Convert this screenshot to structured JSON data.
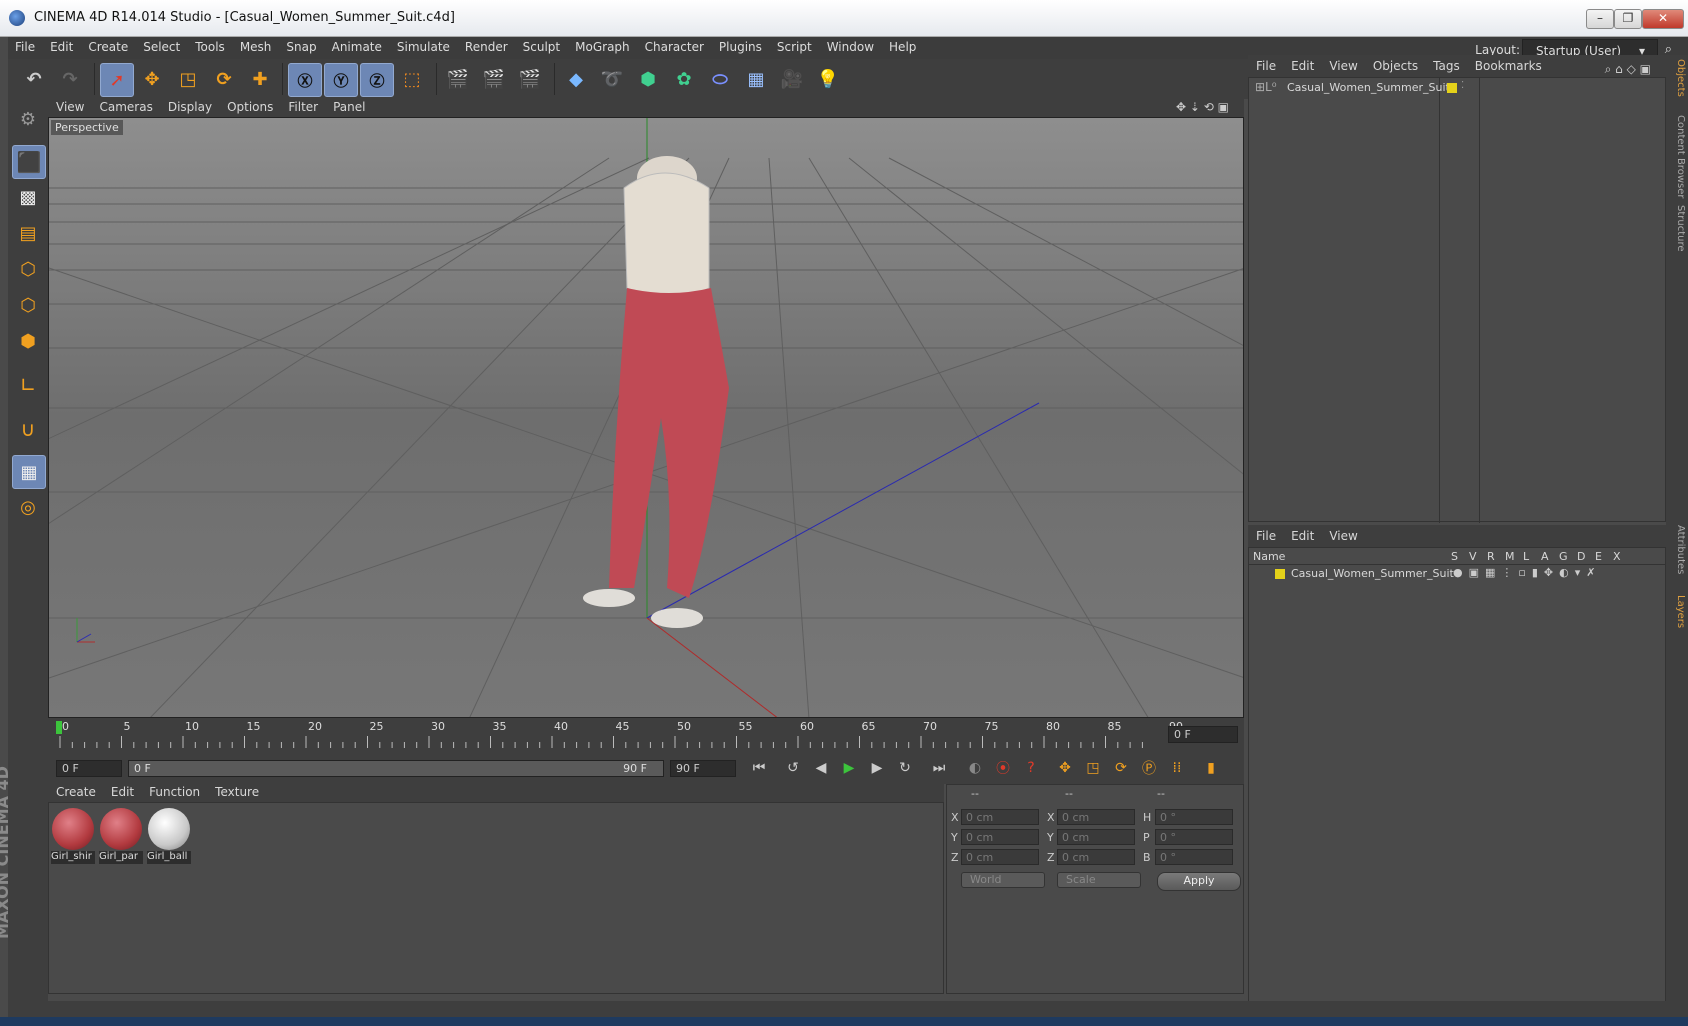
{
  "window": {
    "title": "CINEMA 4D R14.014 Studio - [Casual_Women_Summer_Suit.c4d]",
    "minimize": "–",
    "maximize": "❐",
    "close": "✕"
  },
  "menubar": {
    "items": [
      "File",
      "Edit",
      "Create",
      "Select",
      "Tools",
      "Mesh",
      "Snap",
      "Animate",
      "Simulate",
      "Render",
      "Sculpt",
      "MoGraph",
      "Character",
      "Plugins",
      "Script",
      "Window",
      "Help"
    ],
    "layout_label": "Layout:",
    "layout_value": "Startup (User)"
  },
  "viewport": {
    "menu": [
      "View",
      "Cameras",
      "Display",
      "Options",
      "Filter",
      "Panel"
    ],
    "label": "Perspective"
  },
  "timeline": {
    "ticks": [
      "0",
      "5",
      "10",
      "15",
      "20",
      "25",
      "30",
      "35",
      "40",
      "45",
      "50",
      "55",
      "60",
      "65",
      "70",
      "75",
      "80",
      "85",
      "90"
    ],
    "current_frame": "0 F",
    "start_field": "0 F",
    "range_start": "0 F",
    "range_end": "90 F",
    "end_field": "90 F"
  },
  "material_manager": {
    "menu": [
      "Create",
      "Edit",
      "Function",
      "Texture"
    ],
    "materials": [
      {
        "name": "Girl_shir",
        "color": "#b23a3f"
      },
      {
        "name": "Girl_par",
        "color": "#b23a3f"
      },
      {
        "name": "Girl_ball",
        "color": "#c8c8c8"
      }
    ]
  },
  "coordinates": {
    "headers": [
      "--",
      "--",
      "--"
    ],
    "rows": [
      {
        "a": "X",
        "av": "0 cm",
        "b": "X",
        "bv": "0 cm",
        "c": "H",
        "cv": "0 °"
      },
      {
        "a": "Y",
        "av": "0 cm",
        "b": "Y",
        "bv": "0 cm",
        "c": "P",
        "cv": "0 °"
      },
      {
        "a": "Z",
        "av": "0 cm",
        "b": "Z",
        "bv": "0 cm",
        "c": "B",
        "cv": "0 °"
      }
    ],
    "space": "World",
    "mode": "Scale",
    "apply": "Apply"
  },
  "object_manager": {
    "menu": [
      "File",
      "Edit",
      "View",
      "Objects",
      "Tags",
      "Bookmarks"
    ],
    "object": "Casual_Women_Summer_Suit"
  },
  "layer_manager": {
    "menu": [
      "File",
      "Edit",
      "View"
    ],
    "columns": [
      "Name",
      "S",
      "V",
      "R",
      "M",
      "L",
      "A",
      "G",
      "D",
      "E",
      "X"
    ],
    "layer": "Casual_Women_Summer_Suit"
  },
  "right_tabs": [
    "Objects",
    "Content Browser",
    "Structure",
    "Attributes",
    "Layers"
  ],
  "logo": {
    "line1": "MAXON",
    "line2": "CINEMA 4D"
  },
  "colors": {
    "accent": "#6d87b5",
    "layer_yellow": "#e5d21a",
    "play_green": "#3cc43c"
  }
}
